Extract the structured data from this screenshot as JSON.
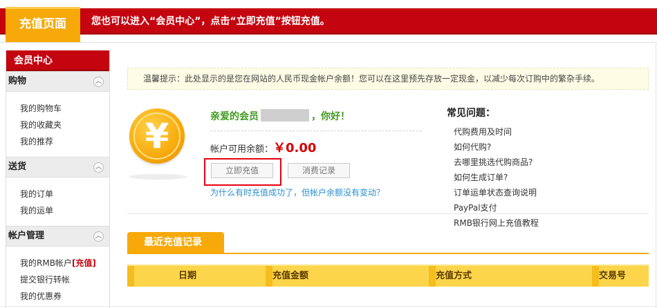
{
  "header": {
    "tab_label": "充值页面",
    "message": "您也可以进入“会员中心”，点击“立即充值”按钮充值。"
  },
  "sidebar": {
    "title": "会员中心",
    "groups": [
      {
        "label": "购物",
        "items": [
          "我的购物车",
          "我的收藏夹",
          "我的推荐"
        ]
      },
      {
        "label": "送货",
        "items": [
          "我的订单",
          "我的运单"
        ]
      },
      {
        "label": "帐户管理",
        "items": [
          "我的RMB帐户",
          "提交银行转帐",
          "我的优惠券"
        ],
        "highlight": "[充值]"
      }
    ]
  },
  "tip": "温馨提示：此处显示的是您在网站的人民币现金帐户余额！您可以在这里预先存放一定现金，以减少每次订购中的繁杂手续。",
  "account": {
    "coin_symbol": "¥",
    "greeting_prefix": "亲爱的会员",
    "greeting_suffix": "，你好！",
    "balance_label": "帐户可用余额：",
    "balance_value": "￥0.00",
    "recharge_button": "立即充值",
    "records_button": "消费记录",
    "help_link": "为什么有时充值成功了，但帐户余额没有变动？"
  },
  "faq": {
    "title": "常见问题：",
    "items": [
      "代购费用及时间",
      "如何代购?",
      "去哪里挑选代购商品?",
      "如何生成订单?",
      "订单运单状态查询说明",
      "PayPal支付",
      "RMB银行网上充值教程"
    ]
  },
  "records": {
    "tab_label": "最近充值记录",
    "columns": [
      "日期",
      "充值金额",
      "充值方式",
      "交易号"
    ]
  },
  "colors": {
    "brand_red": "#c40510",
    "accent_orange": "#f7a90a",
    "greeting_green": "#3f9a1d",
    "amount_red": "#d40000",
    "link_blue": "#2a8fd0"
  }
}
